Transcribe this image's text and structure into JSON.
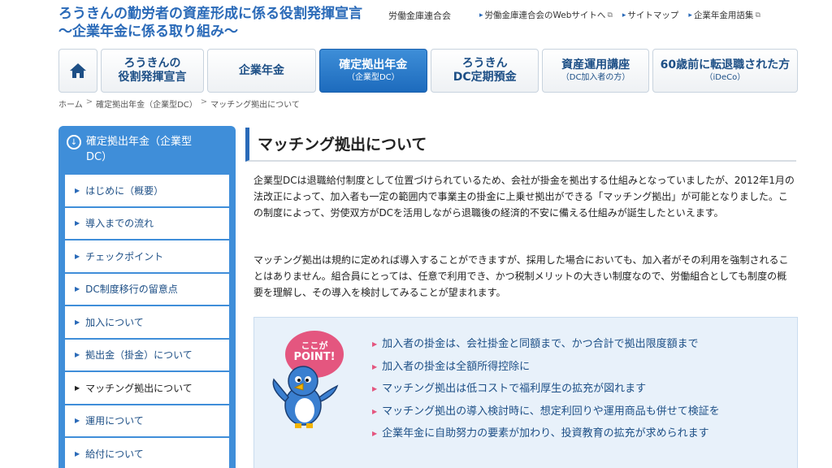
{
  "header": {
    "title_line1": "ろうきんの勤労者の資産形成に係る役割発揮宣言",
    "title_line2": "〜企業年金に係る取り組み〜",
    "org": "労働金庫連合会",
    "links": [
      {
        "label": "労働金庫連合会のWebサイトへ"
      },
      {
        "label": "サイトマップ"
      },
      {
        "label": "企業年金用語集"
      }
    ]
  },
  "nav": {
    "items": [
      {
        "label": "ろうきんの",
        "sub_label": "役割発揮宣言"
      },
      {
        "label": "企業年金",
        "sub_label": ""
      },
      {
        "label": "確定拠出年金",
        "sub_label": "（企業型DC）"
      },
      {
        "label": "ろうきん",
        "sub_label": "DC定期預金"
      },
      {
        "label": "資産運用講座",
        "sub_label": "（DC加入者の方）"
      },
      {
        "label": "60歳前に転退職された方",
        "sub_label": "（iDeCo）"
      }
    ]
  },
  "breadcrumb": [
    "ホーム",
    "確定拠出年金（企業型DC）",
    "マッチング拠出について"
  ],
  "sidebar": {
    "heading_line1": "確定拠出年金（企業型",
    "heading_line2": "DC）",
    "items": [
      {
        "label": "はじめに（概要）"
      },
      {
        "label": "導入までの流れ"
      },
      {
        "label": "チェックポイント"
      },
      {
        "label": "DC制度移行の留意点"
      },
      {
        "label": "加入について"
      },
      {
        "label": "拠出金（掛金）について"
      },
      {
        "label": "マッチング拠出について"
      },
      {
        "label": "運用について"
      },
      {
        "label": "給付について"
      }
    ]
  },
  "main": {
    "title": "マッチング拠出について",
    "paragraph1": "企業型DCは退職給付制度として位置づけられているため、会社が掛金を拠出する仕組みとなっていましたが、2012年1月の法改正によって、加入者も一定の範囲内で事業主の掛金に上乗せ拠出ができる「マッチング拠出」が可能となりました。この制度によって、労使双方がDCを活用しながら退職後の経済的不安に備える仕組みが誕生したといえます。",
    "paragraph2": "マッチング拠出は規約に定めれば導入することができますが、採用した場合においても、加入者がその利用を強制されることはありません。組合員にとっては、任意で利用でき、かつ税制メリットの大きい制度なので、労働組合としても制度の概要を理解し、その導入を検討してみることが望まれます。",
    "point_badge_line1": "ここが",
    "point_badge_line2": "POINT!",
    "points": [
      "加入者の掛金は、会社掛金と同額まで、かつ合計で拠出限度額まで",
      "加入者の掛金は全額所得控除に",
      "マッチング拠出は低コストで福利厚生の拡充が図れます",
      "マッチング拠出の導入検討時に、想定利回りや運用商品も併せて検証を",
      "企業年金に自助努力の要素が加わり、投資教育の拡充が求められます"
    ]
  },
  "colors": {
    "accent_blue": "#3f8ed9",
    "title_blue": "#2a6ab8",
    "point_pink": "#e4567f"
  }
}
